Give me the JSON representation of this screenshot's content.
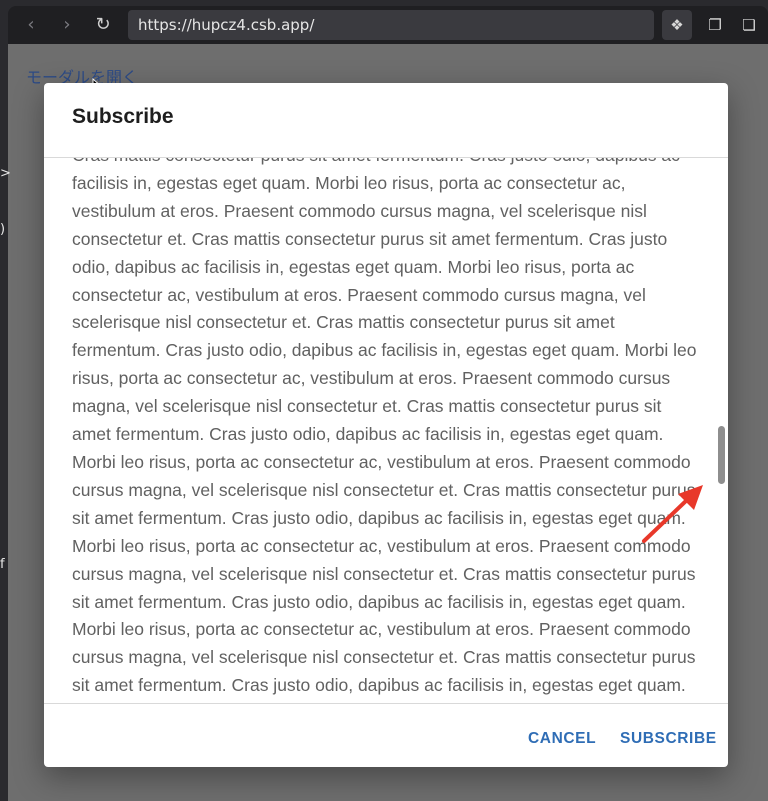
{
  "browser": {
    "back_icon": "back-arrow-icon",
    "forward_icon": "forward-arrow-icon",
    "reload_icon": "reload-icon",
    "url": "https://hupcz4.csb.app/",
    "extension_icon": "diamond-dots-icon",
    "copy_icon": "duplicate-icon",
    "window_icon": "windows-icon"
  },
  "page": {
    "link_text": "モーダルを開く",
    "left_edge_chars": [
      ">",
      ")",
      "f"
    ]
  },
  "modal": {
    "title": "Subscribe",
    "body_text": "Cras mattis consectetur purus sit amet fermentum. Cras justo odio, dapibus ac facilisis in, egestas eget quam. Morbi leo risus, porta ac consectetur ac, vestibulum at eros. Praesent commodo cursus magna, vel scelerisque nisl consectetur et. Cras mattis consectetur purus sit amet fermentum. Cras justo odio, dapibus ac facilisis in, egestas eget quam. Morbi leo risus, porta ac consectetur ac, vestibulum at eros. Praesent commodo cursus magna, vel scelerisque nisl consectetur et. Cras mattis consectetur purus sit amet fermentum. Cras justo odio, dapibus ac facilisis in, egestas eget quam. Morbi leo risus, porta ac consectetur ac, vestibulum at eros. Praesent commodo cursus magna, vel scelerisque nisl consectetur et. Cras mattis consectetur purus sit amet fermentum. Cras justo odio, dapibus ac facilisis in, egestas eget quam. Morbi leo risus, porta ac consectetur ac, vestibulum at eros. Praesent commodo cursus magna, vel scelerisque nisl consectetur et. Cras mattis consectetur purus sit amet fermentum. Cras justo odio, dapibus ac facilisis in, egestas eget quam. Morbi leo risus, porta ac consectetur ac, vestibulum at eros. Praesent commodo cursus magna, vel scelerisque nisl consectetur et. Cras mattis consectetur purus sit amet fermentum. Cras justo odio, dapibus ac facilisis in, egestas eget quam. Morbi leo risus, porta ac consectetur ac, vestibulum at eros. Praesent commodo cursus magna, vel scelerisque nisl consectetur et. Cras mattis consectetur purus sit amet fermentum. Cras justo odio, dapibus ac facilisis in, egestas eget quam.",
    "cancel_label": "CANCEL",
    "subscribe_label": "SUBSCRIBE"
  },
  "colors": {
    "accent": "#2f6db5",
    "annotation_arrow": "#e8382a",
    "backdrop": "#6e6e6e"
  }
}
